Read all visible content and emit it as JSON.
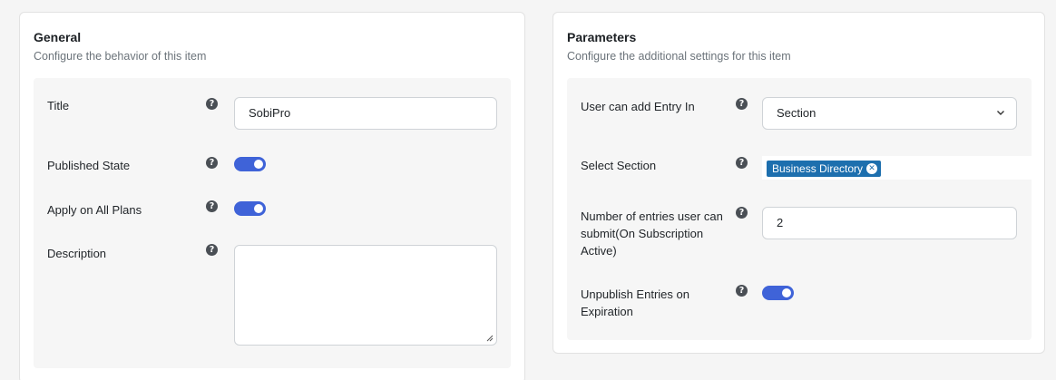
{
  "general": {
    "title": "General",
    "subtitle": "Configure the behavior of this item",
    "fields": {
      "title_label": "Title",
      "title_value": "SobiPro",
      "published_label": "Published State",
      "published_on": true,
      "all_plans_label": "Apply on All Plans",
      "all_plans_on": true,
      "description_label": "Description",
      "description_value": ""
    }
  },
  "parameters": {
    "title": "Parameters",
    "subtitle": "Configure the additional settings for this item",
    "fields": {
      "entry_in_label": "User can add Entry In",
      "entry_in_value": "Section",
      "select_section_label": "Select Section",
      "select_section_tag": "Business Directory",
      "num_entries_label": "Number of entries user can submit(On Subscription Active)",
      "num_entries_value": "2",
      "unpublish_label": "Unpublish Entries on Expiration",
      "unpublish_on": true
    }
  },
  "icons": {
    "help": "question-circle-icon",
    "help_glyph": "?",
    "remove_tag": "close-circle-icon",
    "remove_glyph": "✕",
    "dropdown": "chevron-down-icon"
  },
  "colors": {
    "accent": "#3f63d8",
    "tag": "#1d6fae"
  }
}
